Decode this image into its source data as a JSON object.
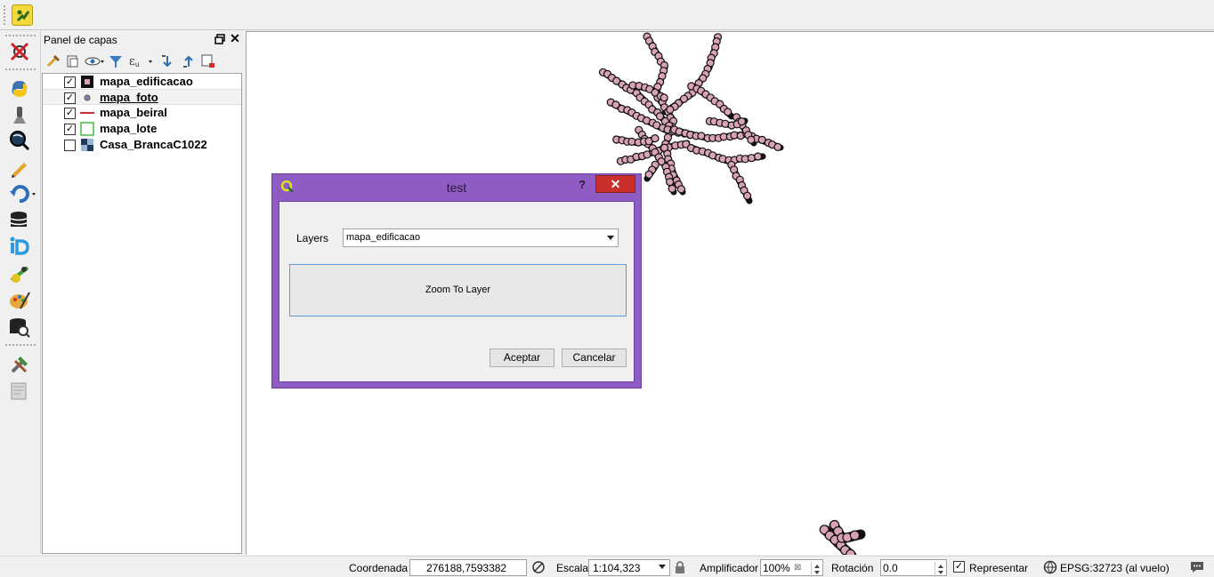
{
  "app": {
    "plugin_icon": "plugin-icon"
  },
  "left_toolbar": {
    "icons": [
      "processing-remove-icon",
      "python-icon",
      "pin-icon",
      "globe-search-icon",
      "edit-pencil-icon",
      "undo-icon",
      "database-manager-icon",
      "id-editor-icon",
      "gps-icon",
      "paint-palette-icon",
      "database-search-icon",
      "tools-icon",
      "map-sheet-icon"
    ]
  },
  "layers_panel": {
    "title": "Panel de capas",
    "layers": [
      {
        "name": "mapa_edificacao",
        "checked": true,
        "symbol": "polygon-fill-pink",
        "selected": false
      },
      {
        "name": "mapa_foto",
        "checked": true,
        "symbol": "point-marker",
        "selected": true
      },
      {
        "name": "mapa_beiral",
        "checked": true,
        "symbol": "line-red",
        "selected": false
      },
      {
        "name": "mapa_lote",
        "checked": true,
        "symbol": "polygon-outline-green",
        "selected": false
      },
      {
        "name": "Casa_BrancaC1022",
        "checked": false,
        "symbol": "raster",
        "selected": false
      }
    ]
  },
  "dialog": {
    "title": "test",
    "help": "?",
    "close": "✕",
    "layers_label": "Layers",
    "selected_layer": "mapa_edificacao",
    "zoom_button": "Zoom To Layer",
    "ok_button": "Aceptar",
    "cancel_button": "Cancelar"
  },
  "status_bar": {
    "coord_label": "Coordenada",
    "coord_value": "276188,7593382",
    "scale_label": "Escala",
    "scale_value": "1:104,323",
    "magnifier_label": "Amplificador",
    "magnifier_value": "100%",
    "rotation_label": "Rotación",
    "rotation_value": "0.0",
    "render_label": "Representar",
    "render_checked": true,
    "crs": "EPSG:32723 (al vuelo)"
  },
  "colors": {
    "dialog_frame": "#8e5cc3",
    "close_red": "#c9302c",
    "feature_fill": "#d7a3b5"
  }
}
